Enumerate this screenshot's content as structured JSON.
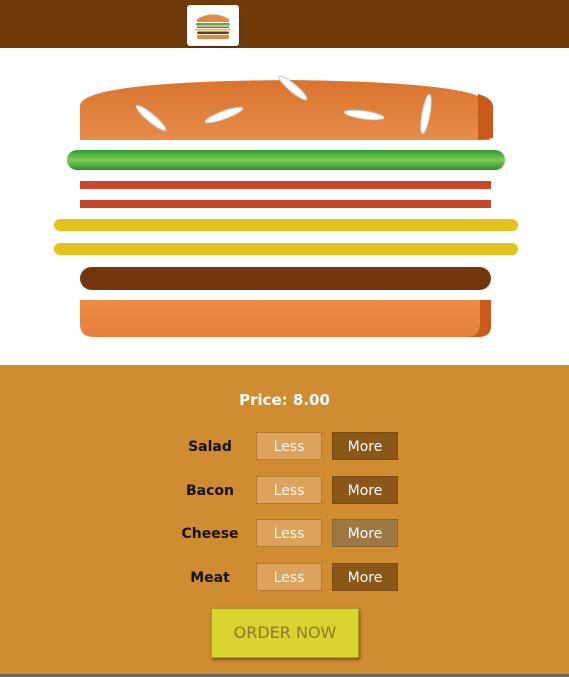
{
  "header": {
    "logo_icon": "burger-logo-icon"
  },
  "price": {
    "label": "Price:",
    "value": "8.00",
    "text": "Price: 8.00"
  },
  "ingredients": [
    {
      "name": "Salad",
      "less_label": "Less",
      "more_label": "More"
    },
    {
      "name": "Bacon",
      "less_label": "Less",
      "more_label": "More"
    },
    {
      "name": "Cheese",
      "less_label": "Less",
      "more_label": "More"
    },
    {
      "name": "Meat",
      "less_label": "Less",
      "more_label": "More"
    }
  ],
  "order_button": {
    "label": "ORDER NOW"
  },
  "colors": {
    "header": "#703b09",
    "panel": "#cf8c30",
    "bun": "#e08a45",
    "salad": "#4db33d",
    "bacon": "#c9482a",
    "cheese": "#e3c21a",
    "meat": "#73360d",
    "more_button": "#8a5719",
    "less_button": "#dda25d",
    "order_button": "#d9d32f"
  }
}
